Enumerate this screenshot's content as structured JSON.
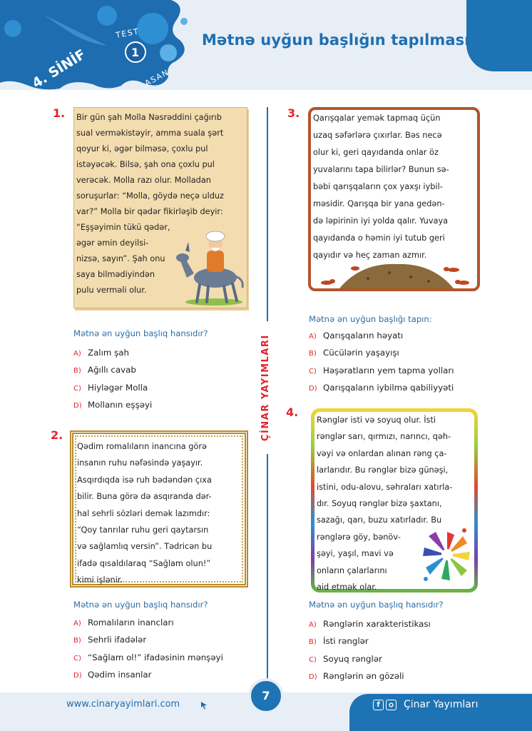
{
  "header": {
    "grade": "4. SİNİF",
    "test_label": "TEST",
    "test_number": "1",
    "level": "ASAN",
    "title": "Mətnə uyğun başlığın tapılması"
  },
  "questions": [
    {
      "number": "1.",
      "passage": [
        "Bir gün şah Molla Nəsrəddini çağırıb",
        "sual verməkistəyir, amma suala şərt",
        "qoyur ki, əgər bilməsə, çoxlu pul",
        "istəyəcək. Bilsə, şah ona çoxlu pul",
        "verəcək. Molla razı olur. Molladan",
        "soruşurlar: “Molla, göydə neçə ulduz",
        "var?” Molla bir qədər fikirləşib deyir:",
        "“Eşşəyimin tükü qədər,",
        "əgər əmin deyilsi-",
        "nizsə, sayın”. Şah onu",
        "saya bilmədiyindən",
        "pulu verməli olur."
      ],
      "prompt": "Mətnə ən uyğun başlıq hansıdır?",
      "options": [
        {
          "letter": "A)",
          "text": "Zalım şah"
        },
        {
          "letter": "B)",
          "text": "Ağıllı cavab"
        },
        {
          "letter": "C)",
          "text": "Hiyləgər Molla"
        },
        {
          "letter": "D)",
          "text": "Mollanın eşşəyi"
        }
      ]
    },
    {
      "number": "2.",
      "passage": [
        "Qədim romalıların inancına görə",
        "insanın ruhu nəfəsində yaşayır.",
        "Asqırdıqda isə ruh bədəndən çıxa",
        "bilir. Buna görə də asqıranda dər-",
        "hal sehrli sözləri demək lazımdır:",
        "“Qoy tanrılar ruhu geri qaytarsın",
        "və sağlamlıq versin”. Tədricən bu",
        "ifadə qısaldılaraq “Sağlam olun!”",
        "kimi işlənir."
      ],
      "prompt": "Mətnə ən uyğun başlıq hansıdır?",
      "options": [
        {
          "letter": "A)",
          "text": "Romalıların inancları"
        },
        {
          "letter": "B)",
          "text": "Sehrli ifadələr"
        },
        {
          "letter": "C)",
          "text": "“Sağlam ol!” ifadəsinin mənşəyi"
        },
        {
          "letter": "D)",
          "text": "Qədim insanlar"
        }
      ]
    },
    {
      "number": "3.",
      "passage": [
        "Qarışqalar yemək tapmaq üçün",
        "uzaq səfərlərə çıxırlar. Bəs necə",
        "olur ki, geri qayıdanda onlar öz",
        "yuvalarını tapa bilirlər? Bunun sə-",
        "bəbi qarışqaların çox yaxşı iybil-",
        "məsidir. Qarışqa bir yana gedən-",
        "də ləpirinin iyi yolda qalır. Yuvaya",
        "qayıdanda o həmin iyi tutub geri",
        "qayıdır və heç zaman azmır."
      ],
      "prompt": "Mətnə ən uyğun başlığı tapın:",
      "options": [
        {
          "letter": "A)",
          "text": "Qarışqaların həyatı"
        },
        {
          "letter": "B)",
          "text": "Cücülərin yaşayışı"
        },
        {
          "letter": "C)",
          "text": "Həşəratların yem tapma yolları"
        },
        {
          "letter": "D)",
          "text": "Qarışqaların iybilmə qabiliyyəti"
        }
      ]
    },
    {
      "number": "4.",
      "passage": [
        "Rənglər isti və soyuq olur. İsti",
        "rənglər sarı, qırmızı, narıncı, qəh-",
        "vəyi və onlardan alınan rəng ça-",
        "larlarıdır. Bu rənglər bizə günəşi,",
        "istini, odu-alovu, səhraları xatırla-",
        "dır. Soyuq rənglər bizə şaxtanı,",
        "sazağı, qarı, buzu xatırladır. Bu",
        "rənglərə göy, bənöv-",
        "şəyi, yaşıl, mavi və",
        "onların çalarlarını",
        "aid etmək olar."
      ],
      "prompt": "Mətnə ən uyğun başlıq hansıdır?",
      "options": [
        {
          "letter": "A)",
          "text": "Rənglərin xarakteristikası"
        },
        {
          "letter": "B)",
          "text": "İsti rənglər"
        },
        {
          "letter": "C)",
          "text": "Soyuq rənglər"
        },
        {
          "letter": "D)",
          "text": "Rənglərin ən gözəli"
        }
      ]
    }
  ],
  "side_brand": "ÇİNAR YAYIMLARI",
  "footer": {
    "url": "www.cinaryayimlari.com",
    "page_number": "7",
    "brand": "Çinar Yayımları"
  },
  "colors": {
    "accent_blue": "#1e73b4",
    "accent_red": "#e0242b",
    "parchment": "#f3ddb0"
  }
}
